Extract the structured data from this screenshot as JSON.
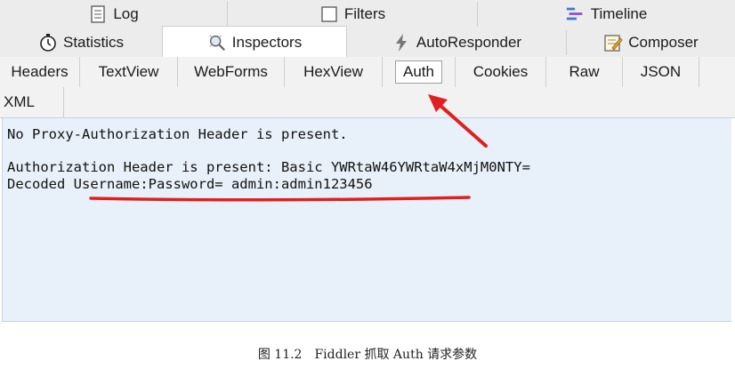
{
  "tabs_row1": [
    {
      "label": "Log",
      "icon": "log-icon"
    },
    {
      "label": "Filters",
      "icon": "filters-icon"
    },
    {
      "label": "Timeline",
      "icon": "timeline-icon"
    }
  ],
  "tabs_row2": [
    {
      "label": "Statistics",
      "icon": "stopwatch-icon"
    },
    {
      "label": "Inspectors",
      "icon": "inspectors-icon"
    },
    {
      "label": "AutoResponder",
      "icon": "lightning-icon"
    },
    {
      "label": "Composer",
      "icon": "composer-icon"
    }
  ],
  "subtabs": [
    "Headers",
    "TextView",
    "WebForms",
    "HexView",
    "Auth",
    "Cookies",
    "Raw",
    "JSON",
    "XML"
  ],
  "active_subtab": "Auth",
  "content": {
    "line1": "No Proxy-Authorization Header is present.",
    "line2": "Authorization Header is present: Basic YWRtaW46YWRtaW4xMjM0NTY=",
    "line3": "Decoded Username:Password= admin:admin123456"
  },
  "annotation_color": "#e02020",
  "caption": "图 11.2　Fiddler 抓取 Auth 请求参数"
}
